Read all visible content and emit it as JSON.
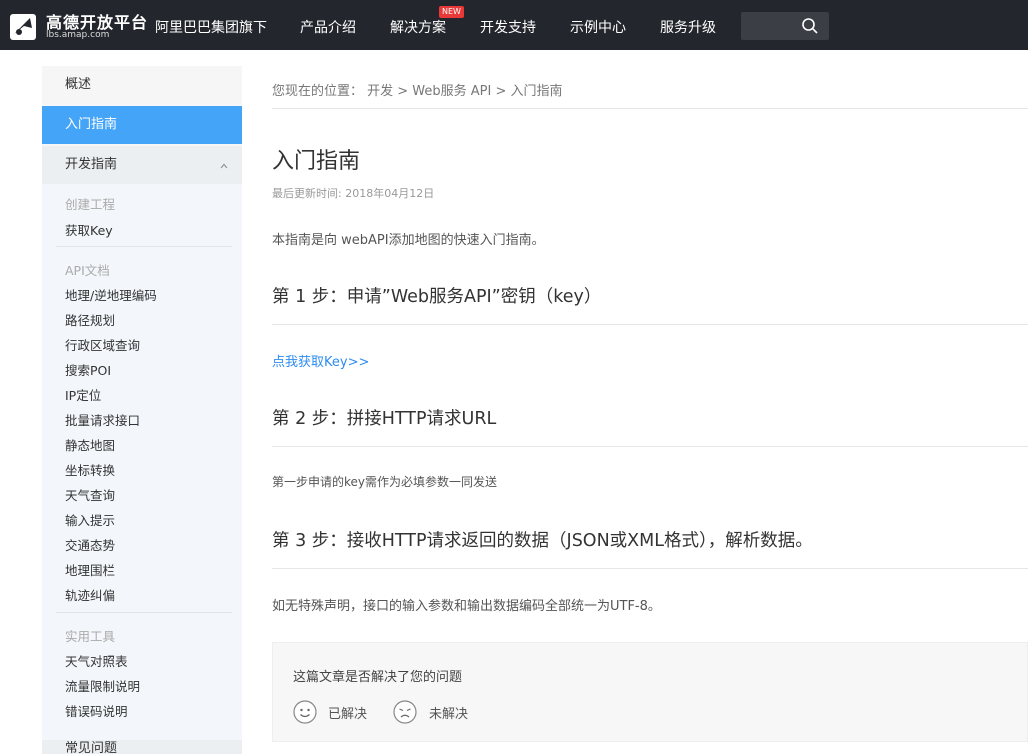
{
  "header": {
    "logo_title": "高德开放平台",
    "logo_subtitle": "lbs.amap.com",
    "nav": [
      "阿里巴巴集团旗下",
      "产品介绍",
      "解决方案",
      "开发支持",
      "示例中心",
      "服务升级"
    ],
    "new_badge": "NEW",
    "search_icon": "search-icon"
  },
  "sidebar": {
    "overview": "概述",
    "getting_started": "入门指南",
    "dev_guide": "开发指南",
    "cat_project": "创建工程",
    "get_key": "获取Key",
    "cat_api": "API文档",
    "api_links": [
      "地理/逆地理编码",
      "路径规划",
      "行政区域查询",
      "搜索POI",
      "IP定位",
      "批量请求接口",
      "静态地图",
      "坐标转换",
      "天气查询",
      "输入提示",
      "交通态势",
      "地理围栏",
      "轨迹纠偏"
    ],
    "cat_tools": "实用工具",
    "tool_links": [
      "天气对照表",
      "流量限制说明",
      "错误码说明"
    ],
    "faq": "常见问题"
  },
  "main": {
    "breadcrumb": "您现在的位置： 开发 > Web服务 API > 入门指南",
    "title": "入门指南",
    "updated": "最后更新时间: 2018年04月12日",
    "intro": "本指南是向 webAPI添加地图的快速入门指南。",
    "step1": "第 1 步：申请”Web服务API”密钥（key）",
    "step1_link": "点我获取Key>>",
    "step2": "第 2 步：拼接HTTP请求URL",
    "step2_text": "第一步申请的key需作为必填参数一同发送",
    "step3": "第 3 步：接收HTTP请求返回的数据（JSON或XML格式），解析数据。",
    "step3_text": "如无特殊声明，接口的输入参数和输出数据编码全部统一为UTF-8。"
  },
  "feedback": {
    "question": "这篇文章是否解决了您的问题",
    "solved": "已解决",
    "unsolved": "未解决"
  },
  "colors": {
    "topbar": "#23262d",
    "accent": "#44a4f7",
    "link": "#2d8cf0"
  }
}
